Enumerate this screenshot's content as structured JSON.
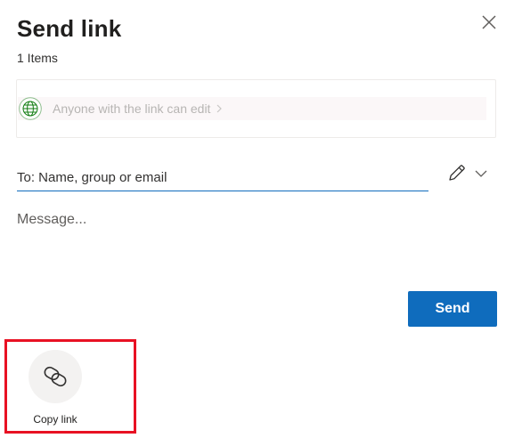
{
  "dialog": {
    "title": "Send link",
    "item_count": "1 Items"
  },
  "permissions": {
    "text": "Anyone with the link can edit",
    "icon": "globe-icon",
    "icon_color": "#107c10"
  },
  "recipients": {
    "placeholder": "To: Name, group or email",
    "value": ""
  },
  "message": {
    "placeholder": "Message...",
    "value": ""
  },
  "actions": {
    "send_label": "Send",
    "send_color": "#0f6cbd"
  },
  "share_options": [
    {
      "label": "Copy link",
      "icon": "link-icon",
      "highlighted": true,
      "highlight_color": "#e81123"
    }
  ]
}
